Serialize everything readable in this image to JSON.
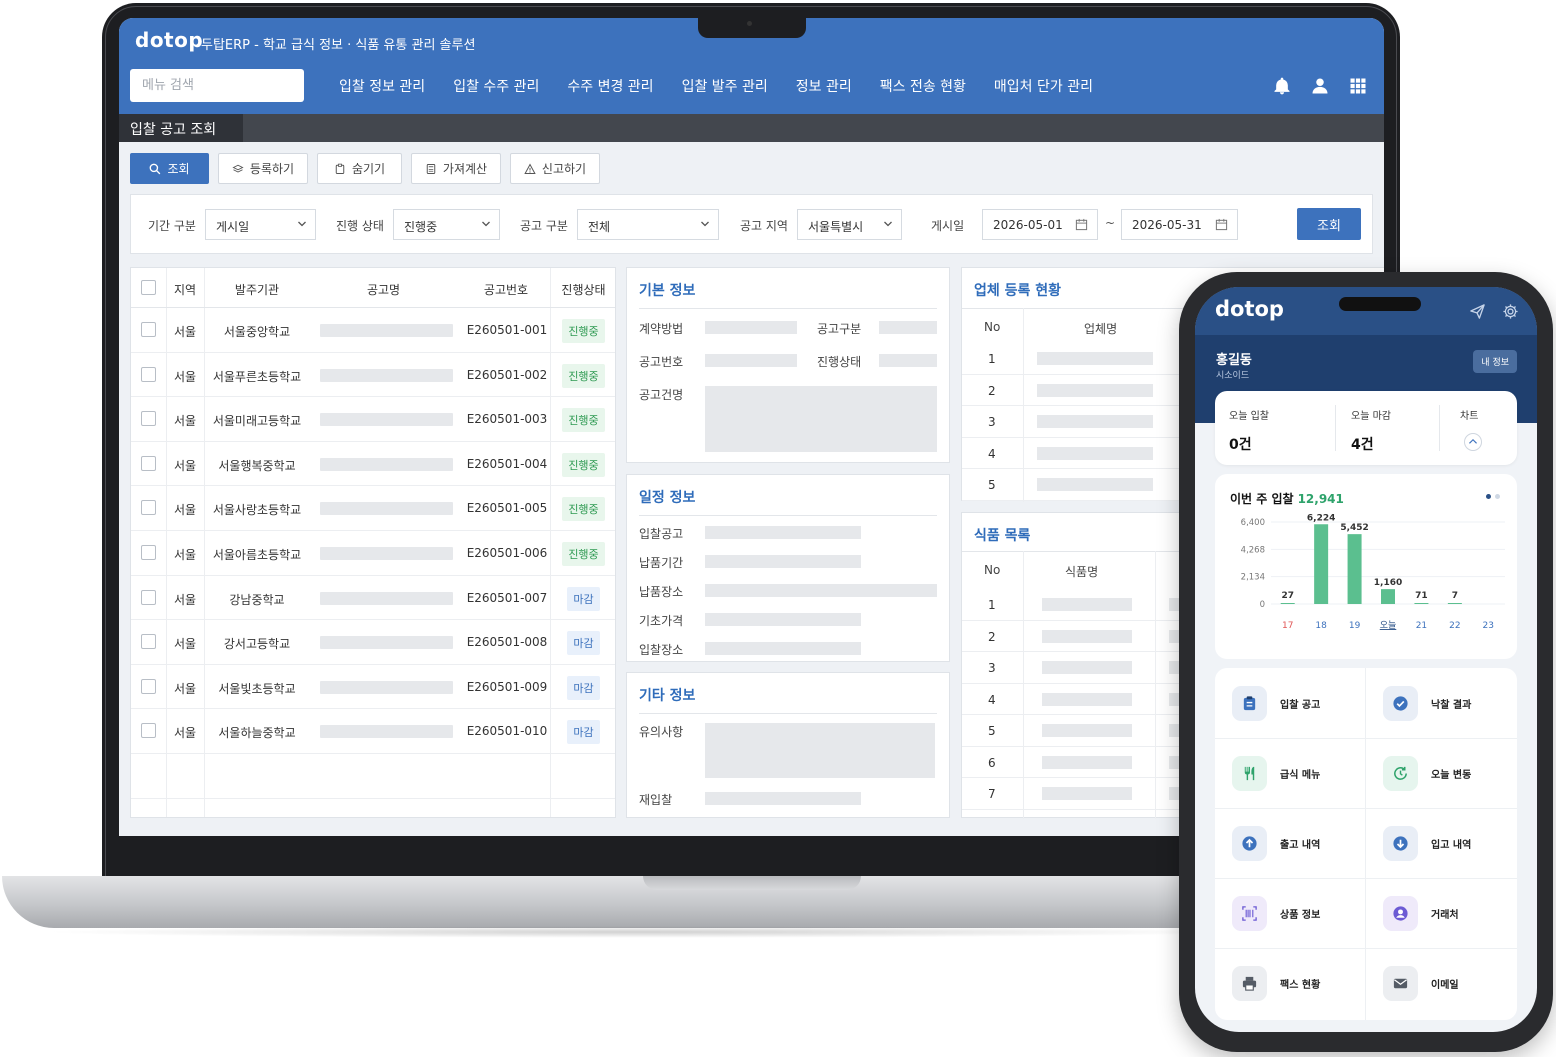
{
  "desktop": {
    "brand": "dotop",
    "app_title": "두탑ERP - 학교 급식 정보 · 식품 유통 관리 솔루션",
    "search_placeholder": "메뉴 검색",
    "nav": [
      "입찰 정보 관리",
      "입찰 수주 관리",
      "수주 변경 관리",
      "입찰 발주 관리",
      "정보 관리",
      "팩스 전송 현황",
      "매입처 단가 관리"
    ],
    "page_title": "입찰 공고 조회",
    "toolbar": {
      "search": "조회",
      "register": "등록하기",
      "hide": "숨기기",
      "import_calc": "가져계산",
      "report": "신고하기"
    },
    "filters": {
      "period_label": "기간 구분",
      "period_value": "게시일",
      "status_label": "진행 상태",
      "status_value": "진행중",
      "type_label": "공고 구분",
      "type_value": "전체",
      "region_label": "공고 지역",
      "region_value": "서울특별시",
      "posted_label": "게시일",
      "date_from": "2026-05-01",
      "date_sep": "~",
      "date_to": "2026-05-31",
      "submit": "조회"
    },
    "list": {
      "headers": [
        "지역",
        "발주기관",
        "공고명",
        "공고번호",
        "진행상태"
      ],
      "rows": [
        {
          "region": "서울",
          "org": "서울중앙학교",
          "no": "E260501-001",
          "status": "진행중",
          "state": "active"
        },
        {
          "region": "서울",
          "org": "서울푸른초등학교",
          "no": "E260501-002",
          "status": "진행중",
          "state": "active"
        },
        {
          "region": "서울",
          "org": "서울미래고등학교",
          "no": "E260501-003",
          "status": "진행중",
          "state": "active"
        },
        {
          "region": "서울",
          "org": "서울행복중학교",
          "no": "E260501-004",
          "status": "진행중",
          "state": "active"
        },
        {
          "region": "서울",
          "org": "서울사랑초등학교",
          "no": "E260501-005",
          "status": "진행중",
          "state": "active"
        },
        {
          "region": "서울",
          "org": "서울아름초등학교",
          "no": "E260501-006",
          "status": "진행중",
          "state": "active"
        },
        {
          "region": "서울",
          "org": "강남중학교",
          "no": "E260501-007",
          "status": "마감",
          "state": "closed"
        },
        {
          "region": "서울",
          "org": "강서고등학교",
          "no": "E260501-008",
          "status": "마감",
          "state": "closed"
        },
        {
          "region": "서울",
          "org": "서울빛초등학교",
          "no": "E260501-009",
          "status": "마감",
          "state": "closed"
        },
        {
          "region": "서울",
          "org": "서울하늘중학교",
          "no": "E260501-010",
          "status": "마감",
          "state": "closed"
        }
      ]
    },
    "basic_info": {
      "title": "기본 정보",
      "contract_method": "계약방법",
      "notice_type": "공고구분",
      "notice_no": "공고번호",
      "progress": "진행상태",
      "notice_name": "공고건명"
    },
    "schedule_info": {
      "title": "일정 정보",
      "fields": [
        "입찰공고",
        "납품기간",
        "납품장소",
        "기초가격",
        "입찰장소"
      ]
    },
    "other_info": {
      "title": "기타 정보",
      "notes": "유의사항",
      "rebid": "재입찰"
    },
    "vendors": {
      "title": "업체 등록 현황",
      "col_no": "No",
      "col_name": "업체명",
      "rows": [
        "1",
        "2",
        "3",
        "4",
        "5"
      ]
    },
    "foods": {
      "title": "식품 목록",
      "col_no": "No",
      "col_name": "식품명",
      "rows": [
        "1",
        "2",
        "3",
        "4",
        "5",
        "6",
        "7"
      ]
    }
  },
  "mobile": {
    "brand": "dotop",
    "user_name": "홍길동",
    "user_sub": "시소이드",
    "my_info": "내 정보",
    "today_bid_label": "오늘 입찰",
    "today_bid_value": "0건",
    "today_close_label": "오늘 마감",
    "today_close_value": "4건",
    "chart_label": "차트",
    "week_title": "이번 주 입찰",
    "week_total": "12,941",
    "menu": [
      "입찰 공고",
      "낙찰 결과",
      "급식 메뉴",
      "오늘 변동",
      "출고 내역",
      "입고 내역",
      "상품 정보",
      "거래처",
      "팩스 현황",
      "이메일"
    ]
  },
  "chart_data": {
    "type": "bar",
    "categories": [
      "17",
      "18",
      "19",
      "오늘",
      "21",
      "22",
      "23"
    ],
    "values": [
      27,
      6224,
      5452,
      1160,
      71,
      7,
      0
    ],
    "value_labels": [
      "27",
      "6,224",
      "5,452",
      "1,160",
      "71",
      "7",
      ""
    ],
    "yticks": [
      "0",
      "2,134",
      "4,268",
      "6,400"
    ],
    "ylim": [
      0,
      6400
    ],
    "bar_color": "#5bbf8f",
    "highlight_colors": {
      "17": "#e05656",
      "오늘": "#2a5086",
      "default": "#3d72bd"
    }
  },
  "colors": {
    "header_blue": "#3d72bd",
    "dark_bar": "#43474e",
    "active_green": "#2e9a52",
    "closed_blue": "#3d72bd",
    "phone_navy": "#1f3f6e"
  }
}
